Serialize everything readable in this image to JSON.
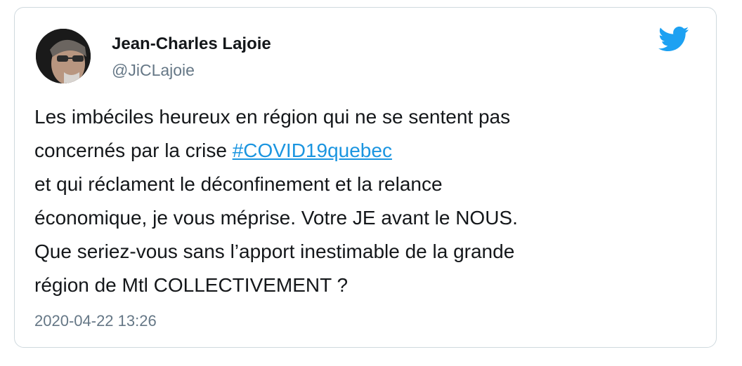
{
  "author": {
    "display_name": "Jean-Charles Lajoie",
    "handle": "@JiCLajoie"
  },
  "tweet": {
    "line1": "Les imbéciles heureux en région qui ne se sentent pas",
    "line2_prefix": "concernés par la crise ",
    "hashtag": "#COVID19quebec",
    "line3": "et qui réclament le déconfinement et la relance",
    "line4": "économique, je vous méprise. Votre JE avant le NOUS.",
    "line5": "Que seriez-vous sans l’apport inestimable de la grande",
    "line6": "région de Mtl COLLECTIVEMENT ?"
  },
  "timestamp": "2020-04-22 13:26",
  "icons": {
    "brand": "twitter-bird-icon"
  },
  "colors": {
    "hashtag": "#1b95e0",
    "twitter_blue": "#1da1f2",
    "secondary_text": "#657786",
    "border": "#cfd9de"
  }
}
